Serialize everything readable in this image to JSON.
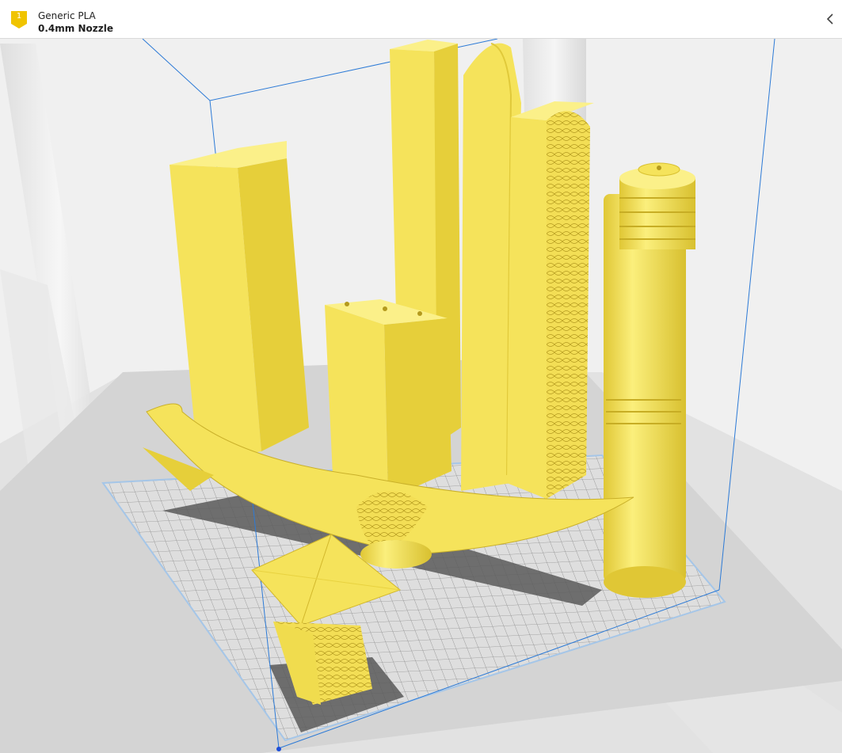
{
  "extruder": {
    "number": "1",
    "material": "Generic PLA",
    "nozzle": "0.4mm Nozzle"
  },
  "icons": {
    "extruder_badge": "extruder-badge-icon",
    "collapse": "chevron-left-icon"
  },
  "colors": {
    "model": "#f5e35b",
    "model_shade": "#e6cf3a",
    "model_light": "#fbf089",
    "badge": "#f0c400",
    "build_volume": "#2c7ad6",
    "grid_line": "#8a8a8a",
    "plate": "#e8e8e8",
    "shadow": "#555555"
  }
}
